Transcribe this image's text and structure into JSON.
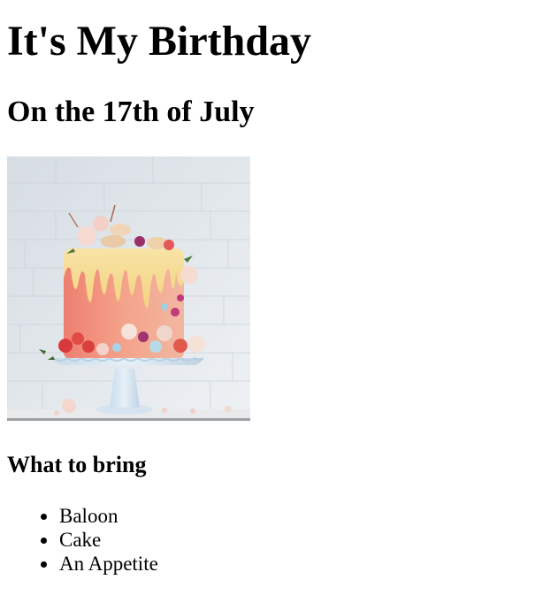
{
  "header": {
    "title": "It's My Birthday",
    "subtitle": "On the 17th of July"
  },
  "image": {
    "alt": "Birthday cake",
    "icon": "cake-image"
  },
  "bring": {
    "heading": "What to bring",
    "items": [
      "Baloon",
      "Cake",
      "An Appetite"
    ]
  },
  "colors": {
    "background": "#ffffff",
    "text": "#000000"
  }
}
